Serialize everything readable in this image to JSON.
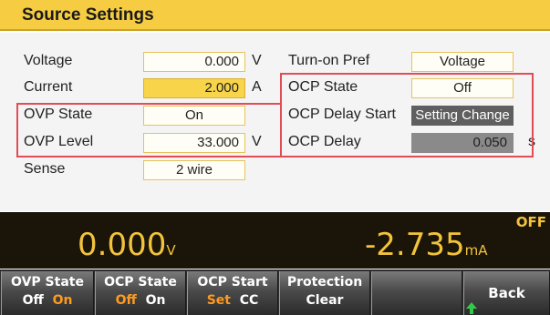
{
  "header": {
    "title": "Source Settings"
  },
  "settings": {
    "voltage": {
      "label": "Voltage",
      "value": "0.000",
      "unit": "V"
    },
    "current": {
      "label": "Current",
      "value": "2.000",
      "unit": "A"
    },
    "ovp_state": {
      "label": "OVP State",
      "value": "On"
    },
    "ovp_level": {
      "label": "OVP Level",
      "value": "33.000",
      "unit": "V"
    },
    "sense": {
      "label": "Sense",
      "value": "2 wire"
    },
    "turn_on_pref": {
      "label": "Turn-on Pref",
      "value": "Voltage"
    },
    "ocp_state": {
      "label": "OCP State",
      "value": "Off"
    },
    "ocp_delay_start": {
      "label": "OCP Delay Start",
      "value": "Setting Change"
    },
    "ocp_delay": {
      "label": "OCP Delay",
      "value": "0.050",
      "unit": "s"
    }
  },
  "status": {
    "voltage_value": "0.000",
    "voltage_unit": "V",
    "current_value": "-2.735",
    "current_unit": "mA",
    "output_state": "OFF"
  },
  "softkeys": [
    {
      "title": "OVP State",
      "opt1": "Off",
      "opt2": "On",
      "active": "On"
    },
    {
      "title": "OCP State",
      "opt1": "Off",
      "opt2": "On",
      "active": "Off"
    },
    {
      "title": "OCP Start",
      "opt1": "Set",
      "opt2": "CC",
      "active": "Set"
    },
    {
      "title": "Protection",
      "sub": "Clear"
    },
    {
      "title": ""
    },
    {
      "title": "Back"
    }
  ],
  "colors": {
    "header_bg": "#f6cc42",
    "highlight_red": "#e24c57",
    "accent_orange": "#ff9a1f",
    "meas_text": "#f2c43c"
  }
}
